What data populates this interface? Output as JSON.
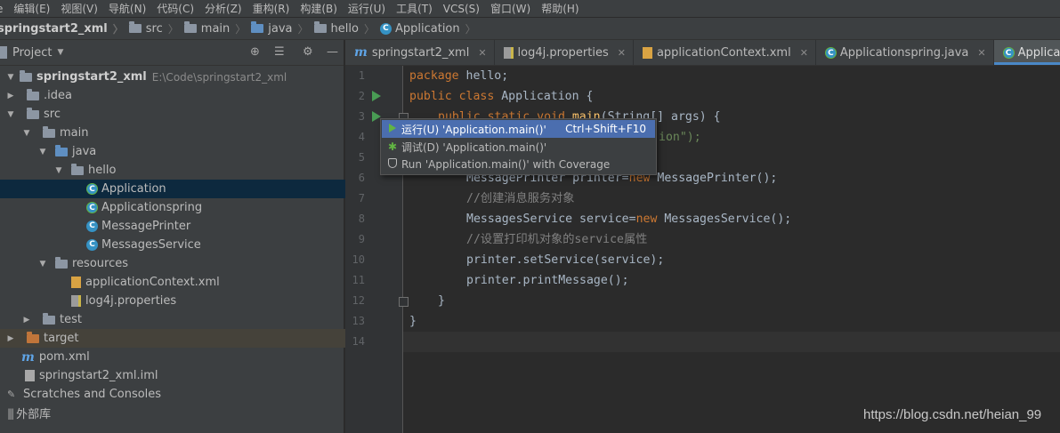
{
  "menu": [
    "e",
    "编辑(E)",
    "视图(V)",
    "导航(N)",
    "代码(C)",
    "分析(Z)",
    "重构(R)",
    "构建(B)",
    "运行(U)",
    "工具(T)",
    "VCS(S)",
    "窗口(W)",
    "帮助(H)"
  ],
  "breadcrumb": [
    "springstart2_xml",
    "src",
    "main",
    "java",
    "hello",
    "Application"
  ],
  "project_panel": {
    "title": "Project",
    "root_name": "springstart2_xml",
    "root_path": "E:\\Code\\springstart2_xml",
    "items": [
      ".idea",
      "src",
      "main",
      "java",
      "hello",
      "Application",
      "Applicationspring",
      "MessagePrinter",
      "MessagesService",
      "resources",
      "applicationContext.xml",
      "log4j.properties",
      "test",
      "target",
      "pom.xml",
      "springstart2_xml.iml",
      "Scratches and Consoles",
      "外部库"
    ]
  },
  "tabs": [
    "springstart2_xml",
    "log4j.properties",
    "applicationContext.xml",
    "Applicationspring.java",
    "Application.java"
  ],
  "editor": {
    "line_numbers": [
      "1",
      "2",
      "3",
      "4",
      "5",
      "6",
      "7",
      "8",
      "9",
      "10",
      "11",
      "12",
      "13",
      "14"
    ],
    "code": {
      "l1_kw": "package",
      "l1_rest": " hello;",
      "l2_kw": "public class",
      "l2_rest": " Application {",
      "l3_a": "public static void ",
      "l3_fn": "main",
      "l3_b": "(String[] args) {",
      "l4_str": "ion\");",
      "l6_type": "MessagePrinter printer=",
      "l6_kw": "new",
      "l6_rest": " MessagePrinter();",
      "l7_comment": "//创建消息服务对象",
      "l8_type": "MessagesService service=",
      "l8_kw": "new",
      "l8_rest": " MessagesService();",
      "l9_comment": "//设置打印机对象的service属性",
      "l10": "printer.setService(service);",
      "l11": "printer.printMessage();",
      "l12": "}",
      "l13": "}"
    }
  },
  "context_menu": {
    "run_label": "运行(U) 'Application.main()'",
    "run_shortcut": "Ctrl+Shift+F10",
    "debug_label": "调试(D) 'Application.main()'",
    "coverage_label": "Run 'Application.main()' with Coverage"
  },
  "watermark": "https://blog.csdn.net/heian_99",
  "colors": {
    "accent": "#4a88c7",
    "selection": "#0d293e",
    "popup_highlight": "#4b6eaf",
    "keyword": "#cc7832",
    "string": "#6a8759"
  }
}
